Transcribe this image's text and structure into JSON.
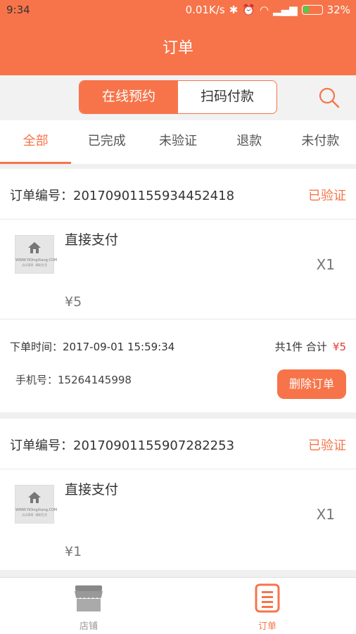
{
  "status_bar": {
    "time": "9:34",
    "speed": "0.01K/s",
    "battery": "32%"
  },
  "header": {
    "title": "订单"
  },
  "segment": {
    "left": "在线预约",
    "right": "扫码付款"
  },
  "tabs": [
    {
      "label": "全部"
    },
    {
      "label": "已完成"
    },
    {
      "label": "未验证"
    },
    {
      "label": "退款"
    },
    {
      "label": "未付款"
    }
  ],
  "orders": [
    {
      "order_no_label": "订单编号：20170901155934452418",
      "status": "已验证",
      "item_name": "直接支付",
      "qty": "X1",
      "price": "¥5",
      "time": "下单时间：2017-09-01 15:59:34",
      "count_text": "共1件  合计",
      "total": "¥5",
      "phone": "手机号：15264145998",
      "delete_label": "删除订单",
      "thumb_line1": "WWW.YiDingXiang.COM",
      "thumb_line2": "点点滴滴 · 精彩生活"
    },
    {
      "order_no_label": "订单编号：20170901155907282253",
      "status": "已验证",
      "item_name": "直接支付",
      "qty": "X1",
      "price": "¥1",
      "thumb_line1": "WWW.YiDingXiang.COM",
      "thumb_line2": "点点滴滴 · 精彩生活"
    }
  ],
  "bottom_nav": {
    "store": "店铺",
    "orders": "订单"
  },
  "colors": {
    "accent": "#f7744a",
    "price_red": "#e53935"
  }
}
